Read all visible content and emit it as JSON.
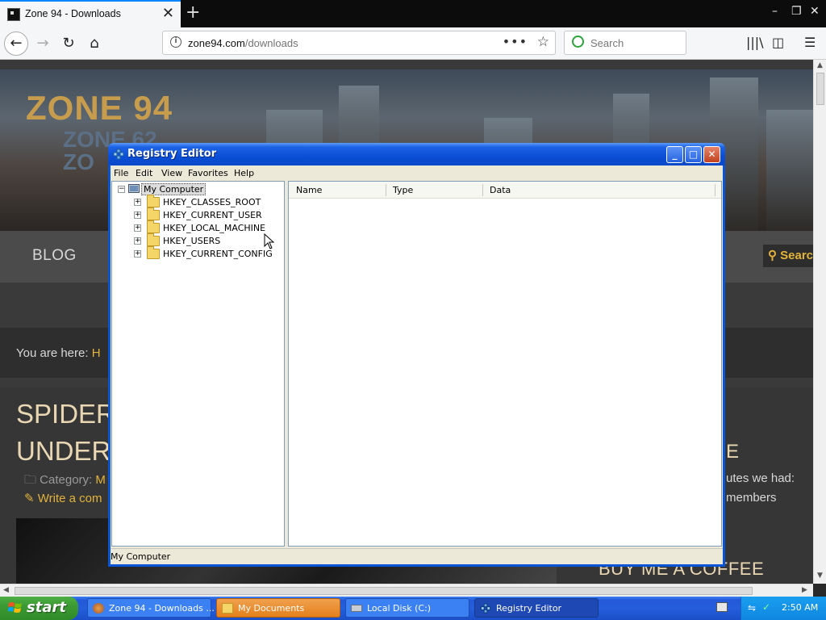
{
  "browser": {
    "tab_title": "Zone 94 - Downloads",
    "url_host": "zone94.com",
    "url_path": "/downloads",
    "search_placeholder": "Search"
  },
  "website": {
    "logo_main": "ZONE 94",
    "logo_sub": "ZONE 62\nZO",
    "nav_blog": "BLOG",
    "search_label": "Searc",
    "breadcrumb_prefix": "You are here:",
    "breadcrumb_link": "H",
    "article_title": "SPIDERB\nUNDERGI",
    "category_label": "Category:",
    "category_value": "M",
    "comment_link": "Write a com",
    "side_heading": "E",
    "side_text1": "utes we had:",
    "side_text2": "members",
    "coffee_heading": "BUY ME A COFFEE"
  },
  "regedit": {
    "title": "Registry Editor",
    "menu": [
      "File",
      "Edit",
      "View",
      "Favorites",
      "Help"
    ],
    "root": "My Computer",
    "hives": [
      "HKEY_CLASSES_ROOT",
      "HKEY_CURRENT_USER",
      "HKEY_LOCAL_MACHINE",
      "HKEY_USERS",
      "HKEY_CURRENT_CONFIG"
    ],
    "columns": [
      "Name",
      "Type",
      "Data"
    ],
    "status": "My Computer"
  },
  "taskbar": {
    "start": "start",
    "tasks": [
      {
        "label": "Zone 94 - Downloads ...",
        "icon": "firefox-icon"
      },
      {
        "label": "My Documents",
        "icon": "folder-icon"
      },
      {
        "label": "Local Disk (C:)",
        "icon": "drive-icon"
      },
      {
        "label": "Registry Editor",
        "icon": "regedit-icon"
      }
    ],
    "clock": "2:50 AM"
  },
  "colors": {
    "xp_blue": "#245edb",
    "start_green": "#3c9a34",
    "accent_gold": "#e3b33a"
  }
}
